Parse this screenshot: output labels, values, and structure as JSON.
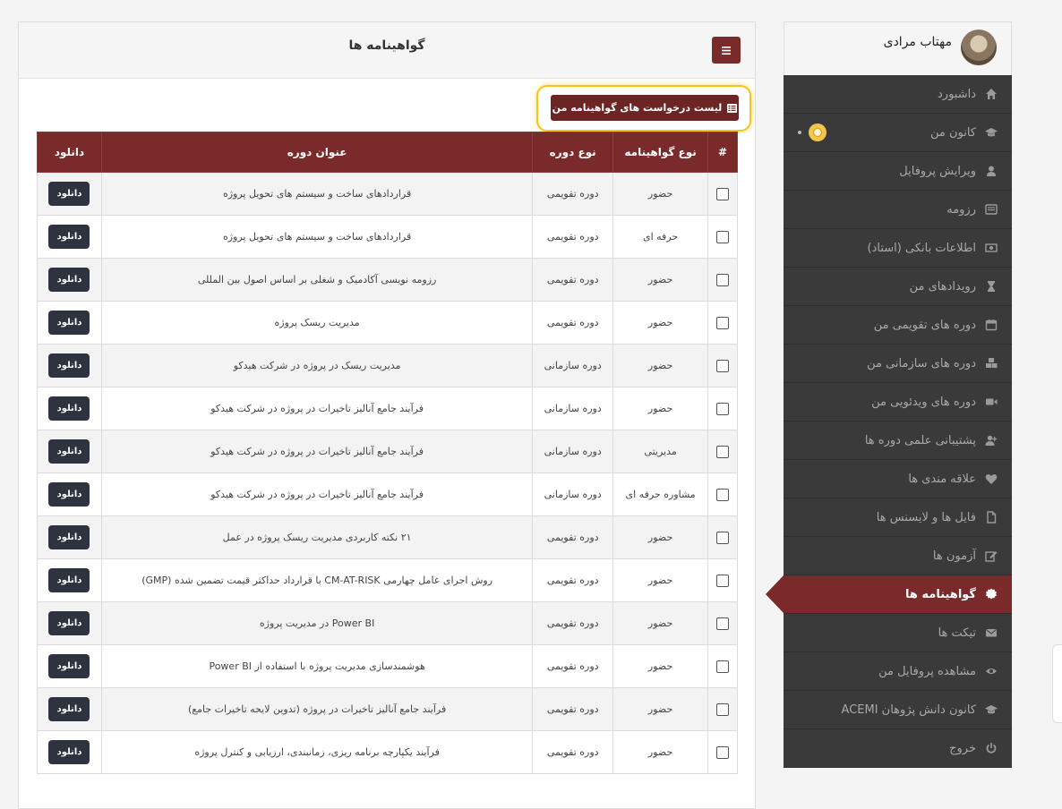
{
  "header": {
    "title": "گواهینامه ها",
    "request_list_label": "لیست درخواست های گواهینامه من"
  },
  "table": {
    "columns": [
      "#",
      "نوع گواهینامه",
      "نوع دوره",
      "عنوان دوره",
      "دانلود"
    ],
    "download_label": "دانلود",
    "rows": [
      {
        "cert_type": "حضور",
        "course_type": "دوره تقویمی",
        "title": "قراردادهای ساخت و سیستم های تحویل پروژه"
      },
      {
        "cert_type": "حرفه ای",
        "course_type": "دوره تقویمی",
        "title": "قراردادهای ساخت و سیستم های تحویل پروژه"
      },
      {
        "cert_type": "حضور",
        "course_type": "دوره تقویمی",
        "title": "رزومه نویسی آکادمیک و شغلی بر اساس اصول بین المللی"
      },
      {
        "cert_type": "حضور",
        "course_type": "دوره تقویمی",
        "title": "مدیریت ریسک پروژه"
      },
      {
        "cert_type": "حضور",
        "course_type": "دوره سازمانی",
        "title": "مدیریت ریسک در پروژه در شرکت هیدکو"
      },
      {
        "cert_type": "حضور",
        "course_type": "دوره سازمانی",
        "title": "فرآیند جامع آنالیز تاخیرات در پروژه در شرکت هیدکو"
      },
      {
        "cert_type": "مدیریتی",
        "course_type": "دوره سازمانی",
        "title": "فرآیند جامع آنالیز تاخیرات در پروژه در شرکت هیدکو"
      },
      {
        "cert_type": "مشاوره حرفه ای",
        "course_type": "دوره سازمانی",
        "title": "فرآیند جامع آنالیز تاخیرات در پروژه در شرکت هیدکو"
      },
      {
        "cert_type": "حضور",
        "course_type": "دوره تقویمی",
        "title": "۲۱ نکته کاربردی مدیریت ریسک پروژه در عمل"
      },
      {
        "cert_type": "حضور",
        "course_type": "دوره تقویمی",
        "title": "روش اجرای عامل چهارمی CM-AT-RISK با قرارداد حداکثر قیمت تضمین شده (GMP)"
      },
      {
        "cert_type": "حضور",
        "course_type": "دوره تقویمی",
        "title": "Power BI در مدیریت پروژه"
      },
      {
        "cert_type": "حضور",
        "course_type": "دوره تقویمی",
        "title": "هوشمندسازی مدیریت پروژه با استفاده از Power BI"
      },
      {
        "cert_type": "حضور",
        "course_type": "دوره تقویمی",
        "title": "فرآیند جامع آنالیز تاخیرات در پروژه (تدوین لایحه تاخیرات جامع)"
      },
      {
        "cert_type": "حضور",
        "course_type": "دوره تقویمی",
        "title": "فرآیند یکپارچه برنامه ریزی، زمانبندی، ارزیابی و کنترل پروژه"
      }
    ]
  },
  "sidebar": {
    "user_name": "مهتاب مرادی",
    "items": [
      {
        "label": "داشبورد",
        "icon": "home-icon"
      },
      {
        "label": "کانون من",
        "icon": "graduation-cap-icon"
      },
      {
        "label": "ویرایش پروفایل",
        "icon": "user-icon"
      },
      {
        "label": "رزومه",
        "icon": "list-alt-icon"
      },
      {
        "label": "اطلاعات بانکی (استاد)",
        "icon": "money-icon"
      },
      {
        "label": "رویدادهای من",
        "icon": "hourglass-icon"
      },
      {
        "label": "دوره های تقویمی من",
        "icon": "calendar-icon"
      },
      {
        "label": "دوره های سازمانی من",
        "icon": "cubes-icon"
      },
      {
        "label": "دوره های ویدئویی من",
        "icon": "video-icon"
      },
      {
        "label": "پشتیبانی علمی دوره ها",
        "icon": "user-plus-icon"
      },
      {
        "label": "علاقه مندی ها",
        "icon": "heart-icon"
      },
      {
        "label": "فایل ها و لایسنس ها",
        "icon": "file-icon"
      },
      {
        "label": "آزمون ها",
        "icon": "edit-icon"
      },
      {
        "label": "گواهینامه ها",
        "icon": "certificate-icon"
      },
      {
        "label": "تیکت ها",
        "icon": "envelope-icon"
      },
      {
        "label": "مشاهده پروفایل من",
        "icon": "eye-icon"
      },
      {
        "label": "کانون دانش پژوهان ACEMI",
        "icon": "graduation-cap-icon"
      },
      {
        "label": "خروج",
        "icon": "power-icon"
      }
    ],
    "active_index": 13
  },
  "colors": {
    "brand": "#7a2a2a",
    "sidebar_bg": "#3a3a3a",
    "download_button": "#2f3340",
    "highlight": "#f5c518"
  }
}
